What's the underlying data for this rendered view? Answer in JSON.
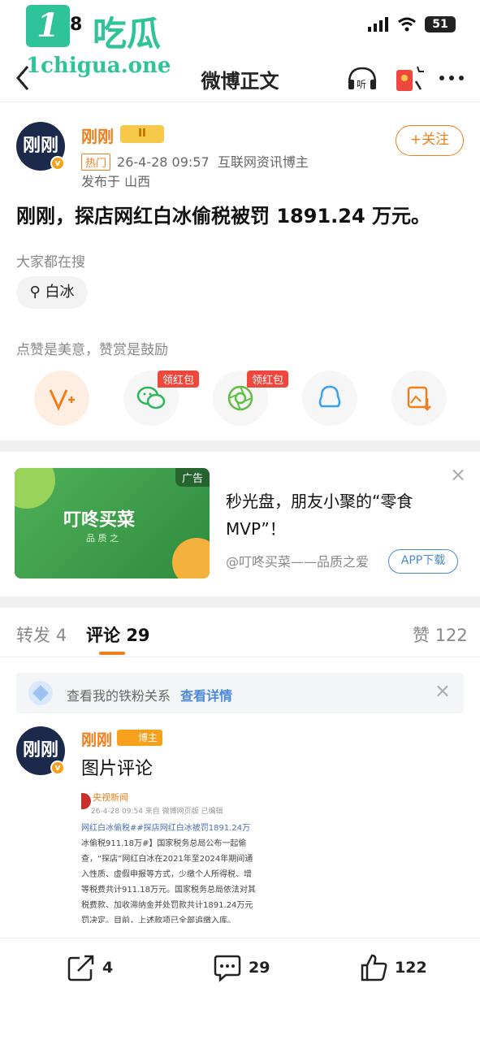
{
  "watermark": {
    "badge": "1",
    "title": "吃瓜",
    "url": "1chigua.one"
  },
  "status_bar": {
    "time": "8",
    "battery": "51"
  },
  "nav": {
    "back": "<",
    "title": "微博正文"
  },
  "post": {
    "avatar_text": "刚刚",
    "author": "刚刚",
    "level_badge": "II",
    "hot_tag": "热门",
    "datetime": "26-4-28 09:57",
    "author_desc": "互联网资讯博主",
    "location": "发布于 山西",
    "follow": "+关注",
    "content": "刚刚，探店网红白冰偷税被罚 1891.24 万元。"
  },
  "search": {
    "label": "大家都在搜",
    "chip": "白冰"
  },
  "reward": {
    "label": "点赞是美意，赞赏是鼓励",
    "red_tag_1": "领红包",
    "red_tag_2": "领红包"
  },
  "ad": {
    "tag": "广告",
    "brand": "叮咚买菜",
    "brand_sub": "品 质 之",
    "title": "秒光盘，朋友小聚的“零食MVP”！",
    "source": "@叮咚买菜——品质之爱",
    "button": "APP下载",
    "close": "×"
  },
  "tabs": {
    "repost_label": "转发",
    "repost_count": "4",
    "comment_label": "评论",
    "comment_count": "29",
    "like_label": "赞",
    "like_count": "122"
  },
  "fans_bar": {
    "text": "查看我的铁粉关系",
    "link": "查看详情",
    "close": "×"
  },
  "comment": {
    "avatar_text": "刚刚",
    "author": "刚刚",
    "badge": "博主",
    "text": "图片评论",
    "image": {
      "source": "央视新闻",
      "meta": "26-4-28 09:54  来自 微博网页版  已编辑",
      "lines": [
        "网红白冰偷税##探店网红白冰被罚1891.24万",
        "冰偷税911.18万#】国家税务总局公布一起偷",
        "查，“探店”网红白冰在2021年至2024年期间通",
        "入性质、虚假申报等方式，少缴个人所得税、增",
        "等税费共计911.18万元。国家税务总局依法对其",
        "税费款、加收滞纳金并处罚款共计1891.24万元",
        "罚决定。目前，上述款项已全部追缴入库。"
      ]
    }
  },
  "bottom_bar": {
    "repost": "4",
    "comment": "29",
    "like": "122"
  },
  "colors": {
    "accent": "#ef7f1a",
    "link": "#4b89d9",
    "red": "#f0473d",
    "watermark": "#2fc39a"
  }
}
